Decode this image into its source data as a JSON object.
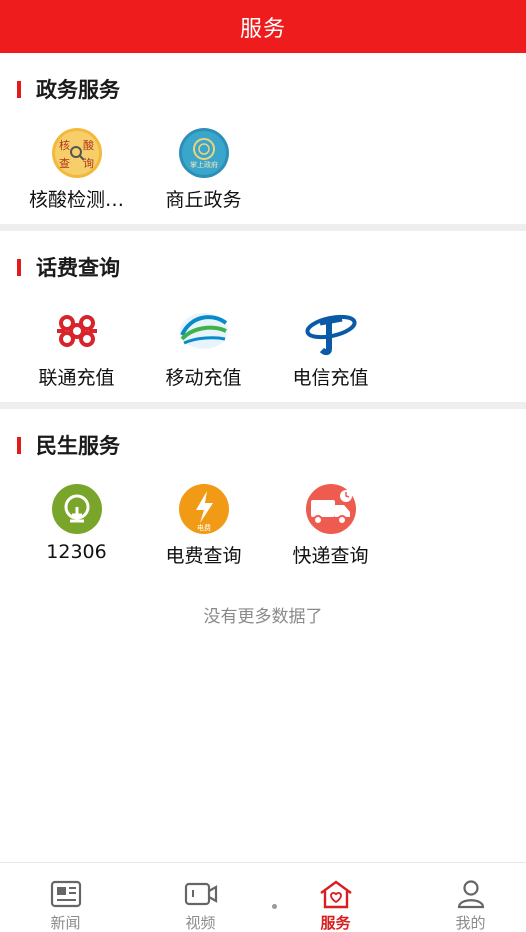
{
  "header": {
    "title": "服务"
  },
  "sections": [
    {
      "title": "政务服务",
      "items": [
        {
          "label": "核酸检测…",
          "icon": "nucleic-test-icon",
          "icon_text_a": "核",
          "icon_text_b": "酸",
          "icon_text_c": "查",
          "icon_text_d": "询"
        },
        {
          "label": "商丘政务",
          "icon": "shangqiu-gov-icon",
          "icon_text": "掌上政府"
        }
      ]
    },
    {
      "title": "话费查询",
      "items": [
        {
          "label": "联通充值",
          "icon": "china-unicom-icon"
        },
        {
          "label": "移动充值",
          "icon": "china-mobile-icon"
        },
        {
          "label": "电信充值",
          "icon": "china-telecom-icon"
        }
      ]
    },
    {
      "title": "民生服务",
      "items": [
        {
          "label": "12306",
          "icon": "railway-12306-icon"
        },
        {
          "label": "电费查询",
          "icon": "electricity-bill-icon",
          "icon_text": "电费"
        },
        {
          "label": "快递查询",
          "icon": "express-delivery-icon"
        }
      ]
    }
  ],
  "footer_note": "没有更多数据了",
  "tabs": [
    {
      "label": "新闻",
      "icon": "news-icon",
      "active": false
    },
    {
      "label": "视频",
      "icon": "video-icon",
      "active": false
    },
    {
      "label": "服务",
      "icon": "service-home-icon",
      "active": true
    },
    {
      "label": "我的",
      "icon": "profile-icon",
      "active": false
    }
  ],
  "colors": {
    "brand": "#ee1c1c",
    "active_tab": "#d81e1e",
    "section_bar": "#e41b1b"
  }
}
